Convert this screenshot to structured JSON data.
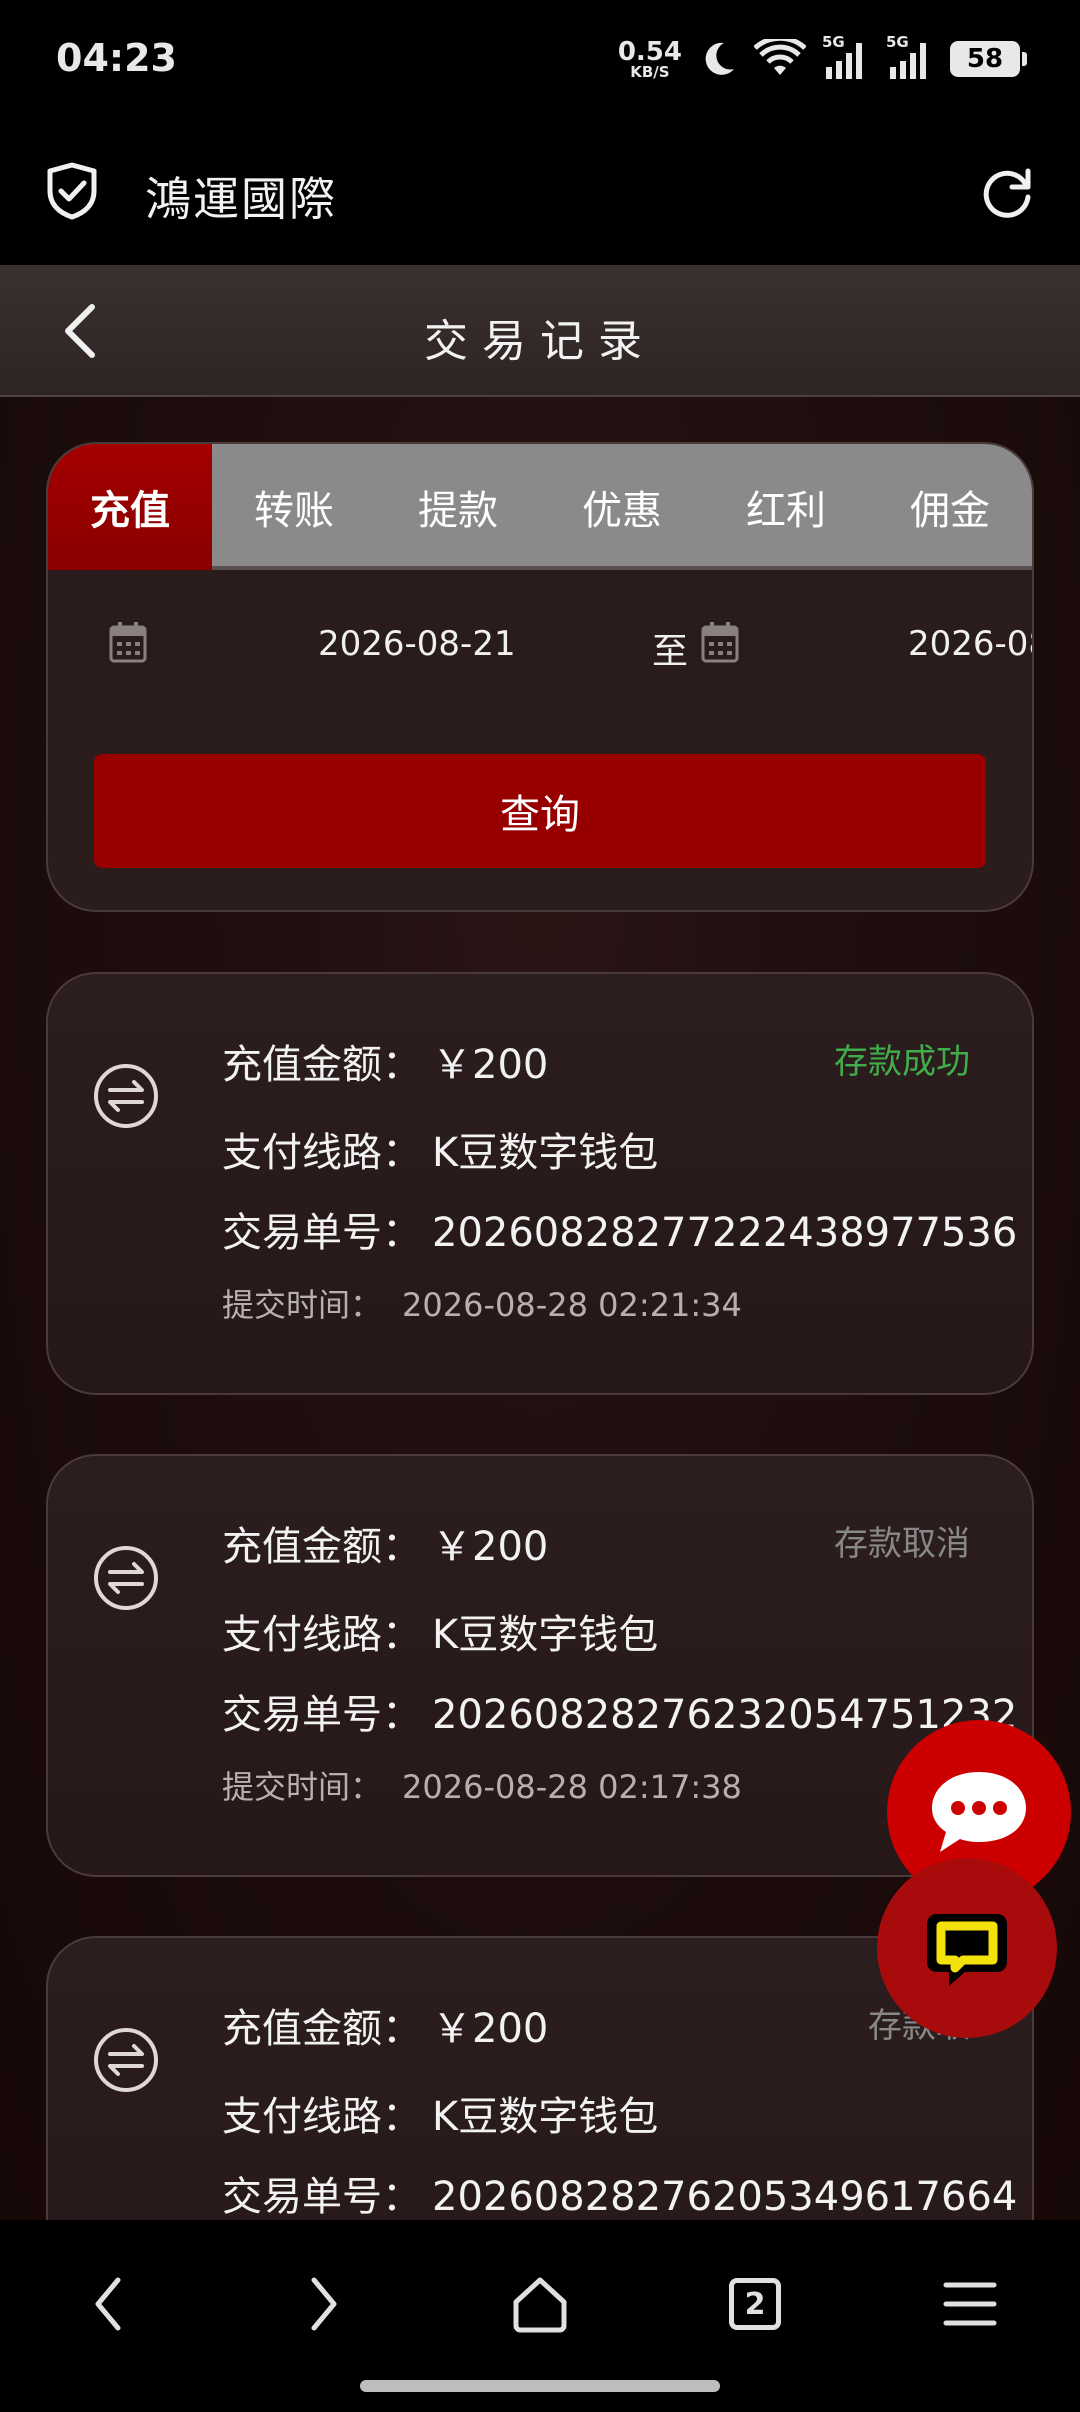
{
  "status_bar": {
    "time": "04:23",
    "net_speed_value": "0.54",
    "net_speed_unit": "KB/S",
    "signal1_label": "5G",
    "signal2_label": "5G",
    "battery": "58"
  },
  "app_bar": {
    "title": "鴻運國際"
  },
  "nav": {
    "title": "交易记录"
  },
  "tabs": [
    {
      "label": "充值",
      "active": true
    },
    {
      "label": "转账",
      "active": false
    },
    {
      "label": "提款",
      "active": false
    },
    {
      "label": "优惠",
      "active": false
    },
    {
      "label": "红利",
      "active": false
    },
    {
      "label": "佣金",
      "active": false
    }
  ],
  "filter": {
    "start_date": "2026-08-21",
    "to_label": "至",
    "end_date": "2026-08",
    "query_label": "查询"
  },
  "records": [
    {
      "amount_label": "充值金额：",
      "amount": "￥200",
      "status": "存款成功",
      "route_label": "支付线路：",
      "route": "K豆数字钱包",
      "order_label": "交易单号：",
      "order": "202608282772224389775​36",
      "time_label": "提交时间：",
      "time": "2026-08-28 02:21:34"
    },
    {
      "amount_label": "充值金额：",
      "amount": "￥200",
      "status": "存款取消",
      "route_label": "支付线路：",
      "route": "K豆数字钱包",
      "order_label": "交易单号：",
      "order": "202608282762320547512​32",
      "time_label": "提交时间：",
      "time": "2026-08-28 02:17:38"
    },
    {
      "amount_label": "充值金额：",
      "amount": "￥200",
      "status": "存款取",
      "route_label": "支付线路：",
      "route": "K豆数字钱包",
      "order_label": "交易单号：",
      "order": "202608282762053496176​64",
      "time_label": "",
      "time": ""
    }
  ],
  "bottom_nav": {
    "tab_count": "2"
  },
  "colors": {
    "accent_red": "#980000",
    "success_green": "#3fae4a",
    "cancel_gray": "#888888"
  }
}
